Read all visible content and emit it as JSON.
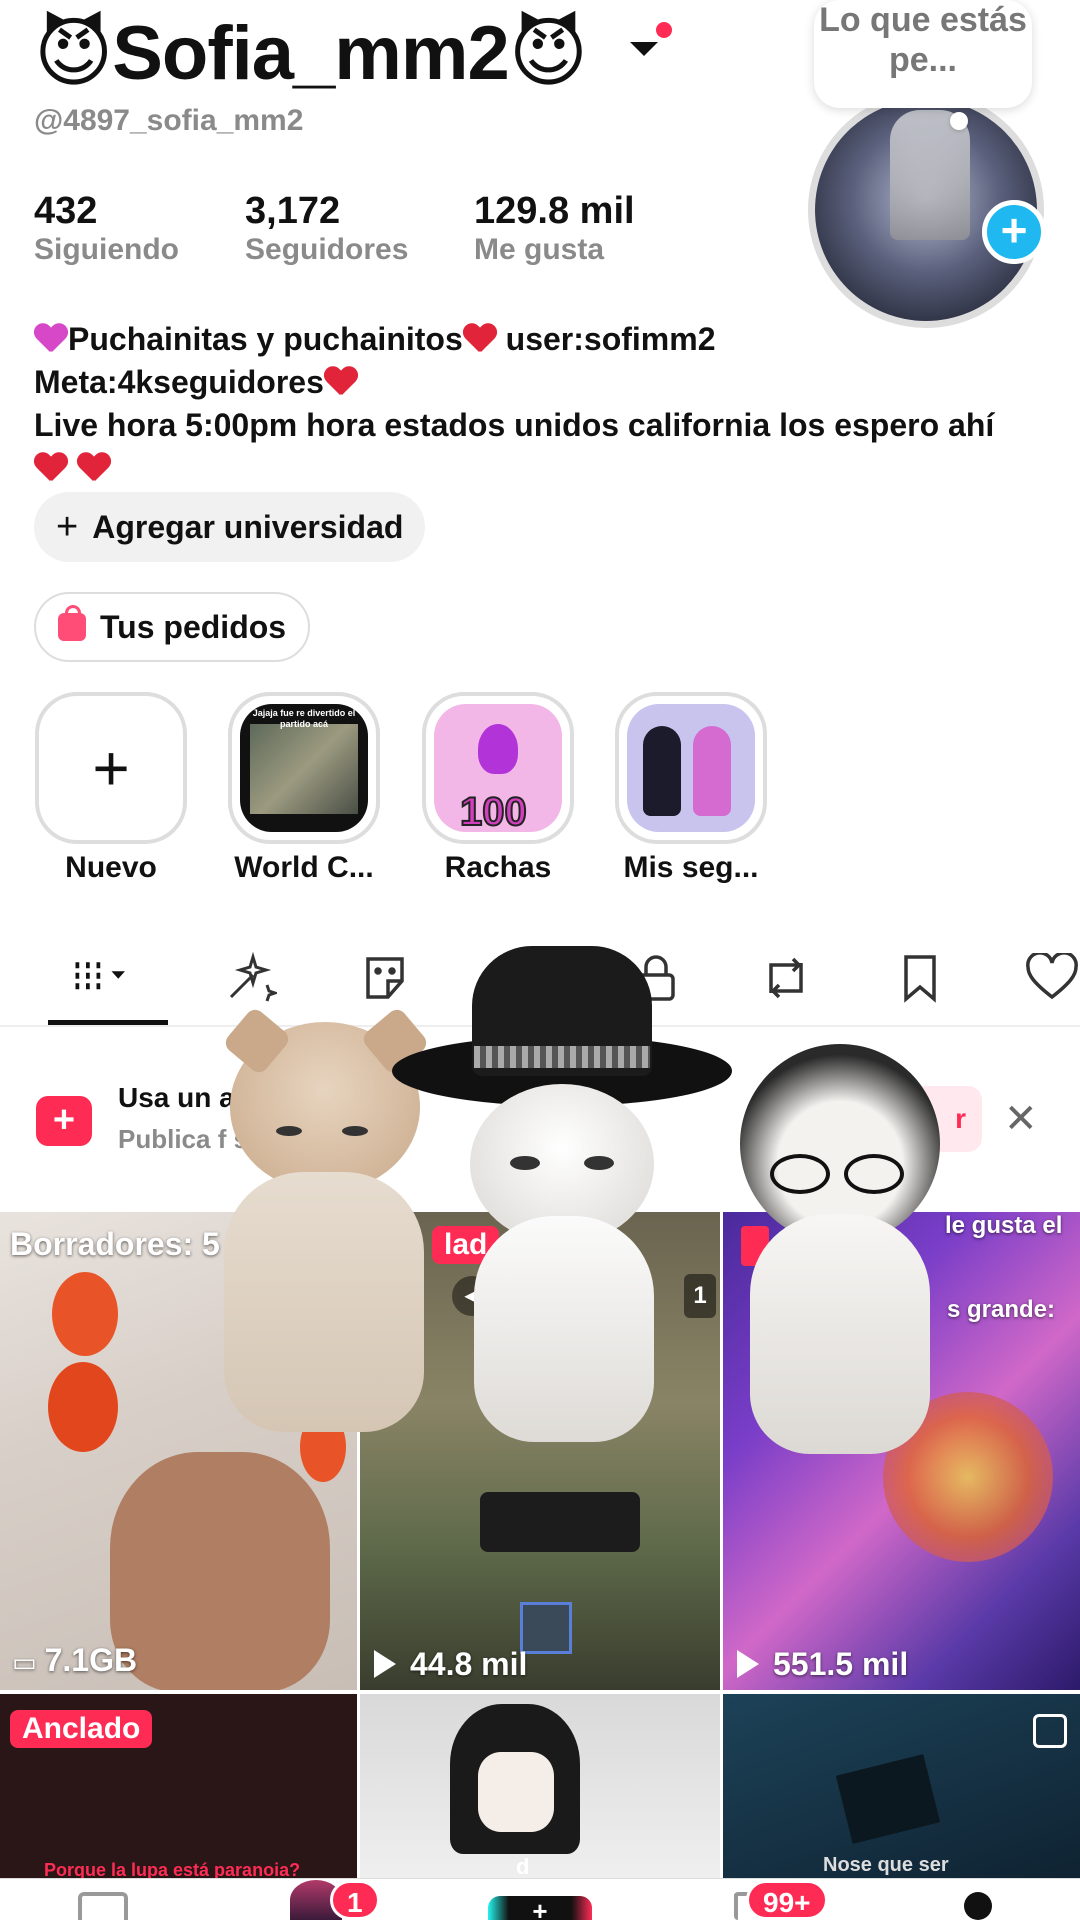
{
  "header": {
    "username": "😈Sofia_mm2😈",
    "handle": "@4897_sofia_mm2",
    "thought_bubble": "Lo que estás pe..."
  },
  "stats": [
    {
      "value": "432",
      "label": "Siguiendo"
    },
    {
      "value": "3,172",
      "label": "Seguidores"
    },
    {
      "value": "129.8 mil",
      "label": "Me gusta"
    }
  ],
  "bio": {
    "line1": "Puchainitas y puchainitos",
    "line1_suffix": " user:sofimm2",
    "line2": "Meta:4kseguidores",
    "line3": "Live hora 5:00pm hora estados unidos california los espero ahí"
  },
  "actions": {
    "add_university": "Agregar universidad",
    "orders": "Tus pedidos"
  },
  "highlights": [
    {
      "label": "Nuevo",
      "icon": "plus-icon"
    },
    {
      "label": "World C...",
      "thumb_text": "Jajaja fue re divertido el partido acá"
    },
    {
      "label": "Rachas",
      "thumb_text": "100"
    },
    {
      "label": "Mis seg..."
    }
  ],
  "tabs": [
    {
      "name": "videos-grid-icon",
      "active": true
    },
    {
      "name": "sparkle-icon"
    },
    {
      "name": "sticker-icon"
    },
    {
      "name": "search-icon"
    },
    {
      "name": "lock-icon"
    },
    {
      "name": "repost-icon"
    },
    {
      "name": "bookmark-icon"
    },
    {
      "name": "heart-icon"
    }
  ],
  "banner": {
    "title": "Usa un        adi        dos",
    "subtitle": "Publica f         segu         zacion",
    "button": "r"
  },
  "grid": [
    {
      "top_label": "Borradores: 5",
      "bottom_label": "7.1GB",
      "bottom_icon": "drafts-icon"
    },
    {
      "pinned_label": "lad",
      "count_badge": "1",
      "bottom_label": "44.8 mil",
      "bottom_icon": "play-icon"
    },
    {
      "top_label": "le gusta el",
      "mid_label": "s grande:",
      "bottom_label": "551.5 mil",
      "bottom_icon": "play-icon"
    },
    {
      "pinned_label": "Anclado",
      "caption": "Porque la lupa está paranoia?"
    },
    {
      "caption": "d"
    },
    {
      "caption": "Nose que ser"
    }
  ],
  "nav": {
    "inbox_badge": "1",
    "activity_badge": "99+"
  },
  "colors": {
    "accent": "#fe2c55",
    "avatar_plus": "#20b8f0",
    "muted": "#8a8a8a"
  }
}
